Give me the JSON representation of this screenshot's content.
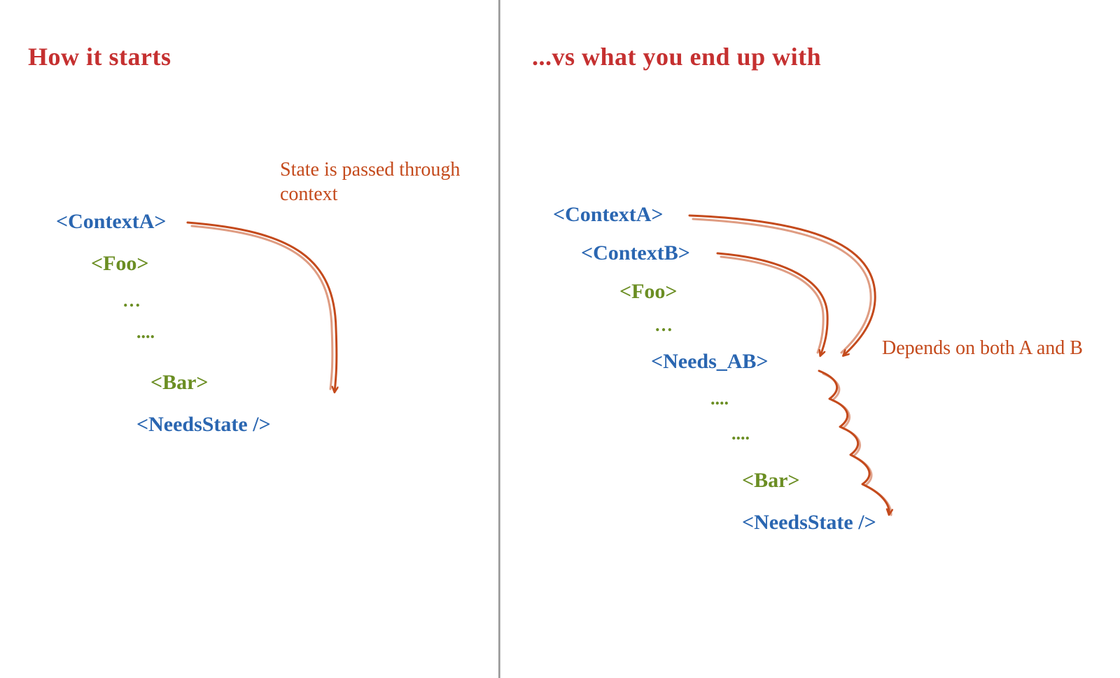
{
  "left": {
    "heading": "How it starts",
    "note": "State is passed through context",
    "tree": {
      "contextA": "<ContextA>",
      "foo": "<Foo>",
      "dots1": "…",
      "dots2": "....",
      "bar": "<Bar>",
      "needsState": "<NeedsState />"
    }
  },
  "right": {
    "heading": "...vs what you end up with",
    "note": "Depends on both A and B",
    "tree": {
      "contextA": "<ContextA>",
      "contextB": "<ContextB>",
      "foo": "<Foo>",
      "dots1": "…",
      "needsAB": "<Needs_AB>",
      "dots2": "....",
      "dots3": "....",
      "bar": "<Bar>",
      "needsState": "<NeedsState />"
    }
  },
  "colors": {
    "heading": "#c53030",
    "note": "#c44a1c",
    "context": "#2a66b1",
    "component": "#6b8e23",
    "arrow": "#c44a1c"
  }
}
